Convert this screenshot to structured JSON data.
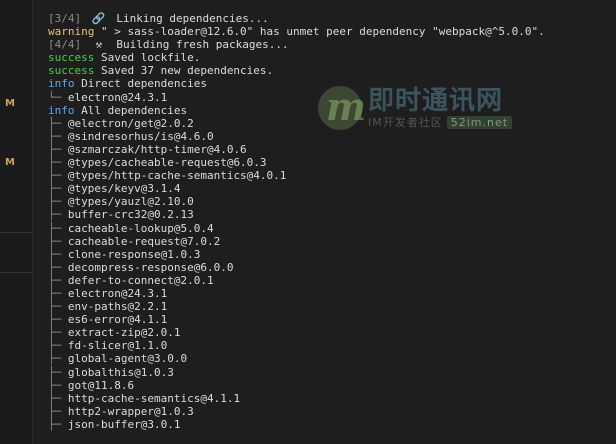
{
  "sidebar": {
    "markers": [
      "M",
      "M"
    ]
  },
  "terminal": {
    "header": [
      {
        "step": "[3/4]",
        "icon": "link-icon",
        "text": "Linking dependencies..."
      },
      {
        "warning_label": "warning",
        "warning_text": "\" > sass-loader@12.6.0\" has unmet peer dependency \"webpack@^5.0.0\"."
      },
      {
        "step": "[4/4]",
        "icon": "hammer-icon",
        "text": "Building fresh packages..."
      }
    ],
    "success_lines": [
      {
        "label": "success",
        "text": "Saved lockfile."
      },
      {
        "label": "success",
        "text": "Saved 37 new dependencies."
      }
    ],
    "direct_header": {
      "label": "info",
      "text": "Direct dependencies"
    },
    "direct_items": [
      "electron@24.3.1"
    ],
    "all_header": {
      "label": "info",
      "text": "All dependencies"
    },
    "all_items": [
      "@electron/get@2.0.2",
      "@sindresorhus/is@4.6.0",
      "@szmarczak/http-timer@4.0.6",
      "@types/cacheable-request@6.0.3",
      "@types/http-cache-semantics@4.0.1",
      "@types/keyv@3.1.4",
      "@types/yauzl@2.10.0",
      "buffer-crc32@0.2.13",
      "cacheable-lookup@5.0.4",
      "cacheable-request@7.0.2",
      "clone-response@1.0.3",
      "decompress-response@6.0.0",
      "defer-to-connect@2.0.1",
      "electron@24.3.1",
      "env-paths@2.2.1",
      "es6-error@4.1.1",
      "extract-zip@2.0.1",
      "fd-slicer@1.1.0",
      "global-agent@3.0.0",
      "globalthis@1.0.3",
      "got@11.8.6",
      "http-cache-semantics@4.1.1",
      "http2-wrapper@1.0.3",
      "json-buffer@3.0.1"
    ]
  },
  "watermark": {
    "letter": "m",
    "title": "即时通讯网",
    "subtitle": "IM开发者社区",
    "domain": "52im.net"
  },
  "colors": {
    "warning": "#e5c07b",
    "success": "#4ec94e",
    "info": "#5fa8e8",
    "dim": "#8a8a8a"
  }
}
